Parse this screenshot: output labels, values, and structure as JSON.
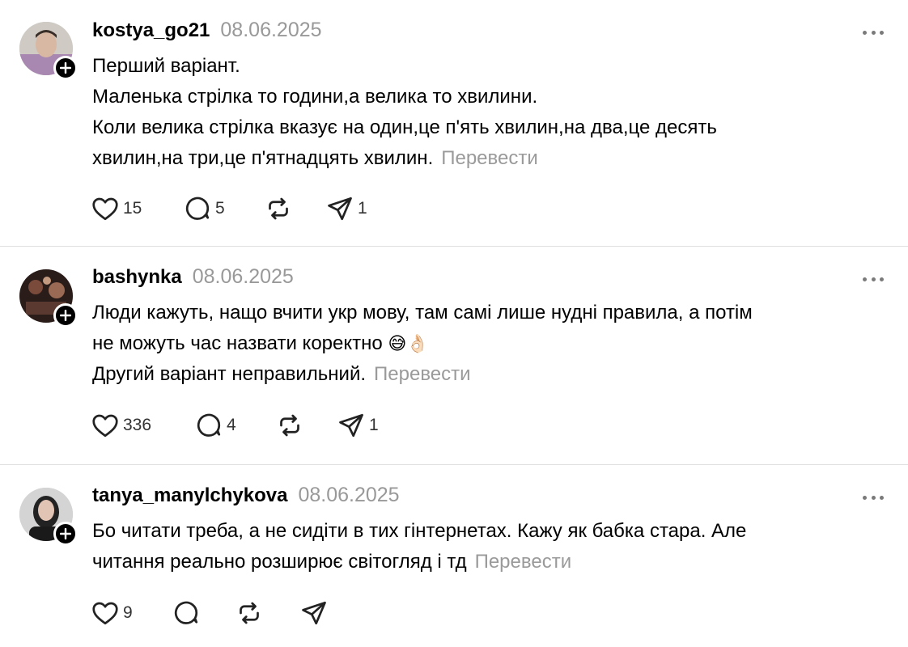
{
  "posts": [
    {
      "username": "kostya_go21",
      "date": "08.06.2025",
      "lines": [
        "Перший варіант.",
        "Маленька стрілка то години,а велика то хвилини.",
        "Коли велика стрілка вказує на один,це п'ять хвилин,на два,це десять",
        "хвилин,на три,це п'ятнадцять хвилин."
      ],
      "translate": "Перевести",
      "likes": "15",
      "comments": "5",
      "reposts": "",
      "shares": "1"
    },
    {
      "username": "bashynka",
      "date": "08.06.2025",
      "lines": [
        "Люди кажуть, нащо вчити укр мову, там самі лише нудні правила, а потім",
        "не можуть час назвати коректно",
        "Другий варіант неправильний."
      ],
      "emoji": "😅👌🏻",
      "translate": "Перевести",
      "likes": "336",
      "comments": "4",
      "reposts": "",
      "shares": "1"
    },
    {
      "username": "tanya_manylchykova",
      "date": "08.06.2025",
      "lines": [
        "Бо читати треба, а не сидіти в тих гінтернетах. Кажу як бабка стара. Але",
        "читання реально розширює світогляд і тд"
      ],
      "translate": "Перевести",
      "likes": "9",
      "comments": "",
      "reposts": "",
      "shares": ""
    }
  ],
  "icons": {
    "like": "heart-icon",
    "comment": "comment-bubble-icon",
    "repost": "repost-icon",
    "share": "send-icon",
    "more": "more-dots-icon",
    "follow": "plus-icon"
  }
}
